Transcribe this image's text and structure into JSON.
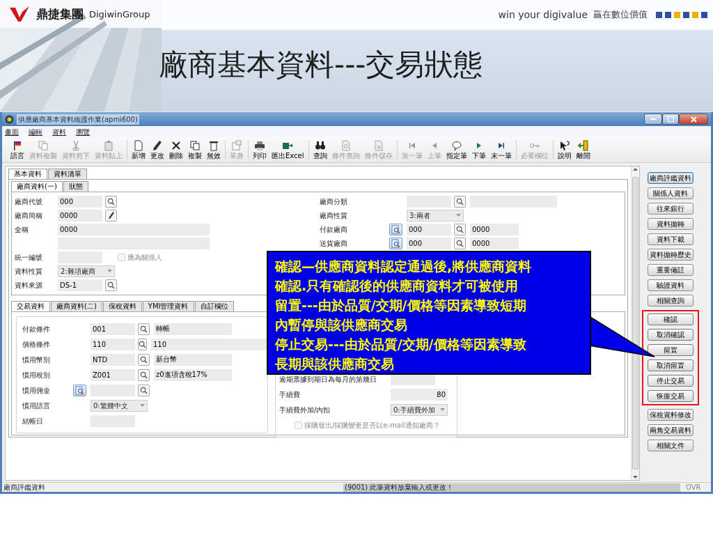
{
  "slide": {
    "logo_cn": "鼎捷集團",
    "logo_en": "DigiwinGroup",
    "slogan_en": "win your digivalue",
    "slogan_cn": "贏在數位價值",
    "squares": [
      {
        "color": "#2f4f9f"
      },
      {
        "color": "#2f4f9f"
      },
      {
        "color": "#f0b400"
      },
      {
        "color": "#2f4f9f"
      },
      {
        "color": "#f0b400"
      },
      {
        "color": "#2f4f9f"
      }
    ],
    "title": "廠商基本資料---交易狀態"
  },
  "window": {
    "title": "供應廠商基本資料維護作業(apmi600)"
  },
  "menu": [
    "畫面",
    "編輯",
    "資料",
    "瀏覽"
  ],
  "toolbar": [
    [
      {
        "label": "語言",
        "disabled": false
      },
      {
        "label": "資料複製",
        "disabled": true
      },
      {
        "label": "資料剪下",
        "disabled": true
      },
      {
        "label": "資料貼上",
        "disabled": true
      }
    ],
    [
      {
        "label": "新增",
        "disabled": false
      },
      {
        "label": "更改",
        "disabled": false
      },
      {
        "label": "刪除",
        "disabled": false
      },
      {
        "label": "複製",
        "disabled": false
      },
      {
        "label": "無效",
        "disabled": false
      }
    ],
    [
      {
        "label": "單身",
        "disabled": true
      }
    ],
    [
      {
        "label": "列印",
        "disabled": false
      },
      {
        "label": "匯出Excel",
        "disabled": false
      }
    ],
    [
      {
        "label": "查詢",
        "disabled": false
      },
      {
        "label": "條件查詢",
        "disabled": true
      },
      {
        "label": "條件儲存",
        "disabled": true
      }
    ],
    [
      {
        "label": "第一筆",
        "disabled": true
      },
      {
        "label": "上筆",
        "disabled": true
      },
      {
        "label": "指定筆",
        "disabled": false
      },
      {
        "label": "下筆",
        "disabled": false
      },
      {
        "label": "末一筆",
        "disabled": false
      }
    ],
    [
      {
        "label": "必要欄位",
        "disabled": true
      }
    ],
    [
      {
        "label": "說明",
        "disabled": false
      },
      {
        "label": "離開",
        "disabled": false
      }
    ]
  ],
  "main_tabs": [
    {
      "label": "基本資料",
      "selected": true
    },
    {
      "label": "資料清單",
      "selected": false
    }
  ],
  "sub_tabs": [
    {
      "label": "廠商資料(一)",
      "selected": true
    },
    {
      "label": "狀態",
      "selected": false
    }
  ],
  "basic_left": [
    {
      "label": "廠商代號",
      "field": {
        "kind": "search",
        "value": "000"
      }
    },
    {
      "label": "廠商簡稱",
      "field": {
        "kind": "edit",
        "value": "0000"
      }
    },
    {
      "label": "全稱",
      "field": {
        "kind": "wide",
        "value": "0000"
      }
    },
    {
      "field": {
        "kind": "wide"
      }
    },
    {
      "label": "統一編號",
      "field": {
        "kind": "text"
      },
      "checkbox": {
        "label": "應為關係人",
        "checked": false,
        "disabled": true
      }
    },
    {
      "label": "資料性質",
      "field": {
        "kind": "select",
        "value": "2:雜項廠商"
      }
    },
    {
      "label": "資料來源",
      "field": {
        "kind": "search",
        "value": "DS-1"
      }
    }
  ],
  "basic_right": [
    {
      "label": "廠商分類",
      "lookup_button": false,
      "field": {
        "kind": "search"
      },
      "description": {
        "kind": "wide"
      }
    },
    {
      "label": "廠商性質",
      "lookup_button": false,
      "field": {
        "kind": "select",
        "value": "3:兩者"
      }
    },
    {
      "label": "付款廠商",
      "lookup_button": true,
      "field": {
        "kind": "search",
        "value": "000"
      },
      "description": {
        "kind": "text",
        "value": "0000"
      }
    },
    {
      "label": "送貨廠商",
      "lookup_button": true,
      "field": {
        "kind": "search",
        "value": "000"
      },
      "description": {
        "kind": "text",
        "value": "0000"
      }
    }
  ],
  "detail_tabs": [
    {
      "label": "交易資料",
      "selected": true
    },
    {
      "label": "廠商資料(二)",
      "selected": false
    },
    {
      "label": "保稅資料",
      "selected": false
    },
    {
      "label": "YMI管理資料",
      "selected": false
    },
    {
      "label": "自訂欄位",
      "selected": false
    }
  ],
  "trade_left": [
    {
      "label": "付款條件",
      "lookup_button": false,
      "field": {
        "kind": "search",
        "value": "001"
      },
      "description": {
        "kind": "text",
        "value": "轉帳"
      }
    },
    {
      "label": "價格條件",
      "lookup_button": false,
      "field": {
        "kind": "search",
        "value": "110"
      },
      "description": {
        "kind": "wide",
        "value": "110"
      }
    },
    {
      "label": "慣用幣別",
      "lookup_button": false,
      "field": {
        "kind": "search",
        "value": "NTD"
      },
      "description": {
        "kind": "text",
        "value": "新台幣"
      }
    },
    {
      "label": "慣用稅別",
      "lookup_button": false,
      "field": {
        "kind": "search",
        "value": "Z001"
      },
      "description": {
        "kind": "text",
        "value": "z0進項含稅17%"
      }
    },
    {
      "label": "慣用佣金",
      "lookup_button": true,
      "field": {
        "kind": "search"
      }
    },
    {
      "label": "慣用語言",
      "lookup_button": false,
      "field": {
        "kind": "select",
        "value": "0:繁體中文"
      }
    },
    {
      "label": "結帳日",
      "lookup_button": false,
      "field": {
        "kind": "text"
      }
    }
  ],
  "trade_right": [
    {
      "label": "逾期票據到期日為每月的第幾日",
      "field": {
        "kind": "text"
      }
    },
    {
      "label": "手續費",
      "field": {
        "kind": "number",
        "value": "80"
      }
    },
    {
      "label": "手續費外加/內扣",
      "field": {
        "kind": "select",
        "value": "0:手續費外加"
      }
    },
    {
      "checkbox": {
        "label": "採購發出/採購變更是否以e-mail通知廠商？",
        "checked": false,
        "disabled": true
      }
    }
  ],
  "side_buttons": [
    {
      "label": "廠商評鑑資料",
      "focused": true,
      "highlighted": false
    },
    {
      "label": "關係人資料",
      "focused": false,
      "highlighted": false
    },
    {
      "label": "往來銀行",
      "focused": false,
      "highlighted": false
    },
    {
      "label": "資料拋轉",
      "focused": false,
      "highlighted": false
    },
    {
      "label": "資料下載",
      "focused": false,
      "highlighted": false
    },
    {
      "label": "資料拋轉歷史",
      "focused": false,
      "highlighted": false
    },
    {
      "label": "重要備註",
      "focused": false,
      "highlighted": false
    },
    {
      "label": "驗證資料",
      "focused": false,
      "highlighted": false
    },
    {
      "label": "相關查詢",
      "focused": false,
      "highlighted": false
    },
    {
      "label": "確認",
      "focused": false,
      "highlighted": true
    },
    {
      "label": "取消確認",
      "focused": false,
      "highlighted": true
    },
    {
      "label": "留置",
      "focused": false,
      "highlighted": true
    },
    {
      "label": "取消留置",
      "focused": false,
      "highlighted": true
    },
    {
      "label": "停止交易",
      "focused": false,
      "highlighted": true
    },
    {
      "label": "恢復交易",
      "focused": false,
      "highlighted": true
    },
    {
      "label": "保稅資料修改",
      "focused": false,
      "highlighted": false
    },
    {
      "label": "兩角交易資料",
      "focused": false,
      "highlighted": false
    },
    {
      "label": "相關文件",
      "focused": false,
      "highlighted": false
    }
  ],
  "status_bar": {
    "left": "廠商評鑑資料",
    "message": "(9001) 此筆資料放棄輸入或更改！",
    "mode": "OVR"
  },
  "callout": {
    "lines": [
      "確認—供應商資料認定通過後,將供應商資料",
      "確認.只有確認後的供應商資料才可被使用",
      "留置---由於品質/交期/價格等因素導致短期",
      "內暫停與該供應商交易",
      "停止交易---由於品質/交期/價格等因素導致",
      "長期與該供應商交易"
    ]
  }
}
